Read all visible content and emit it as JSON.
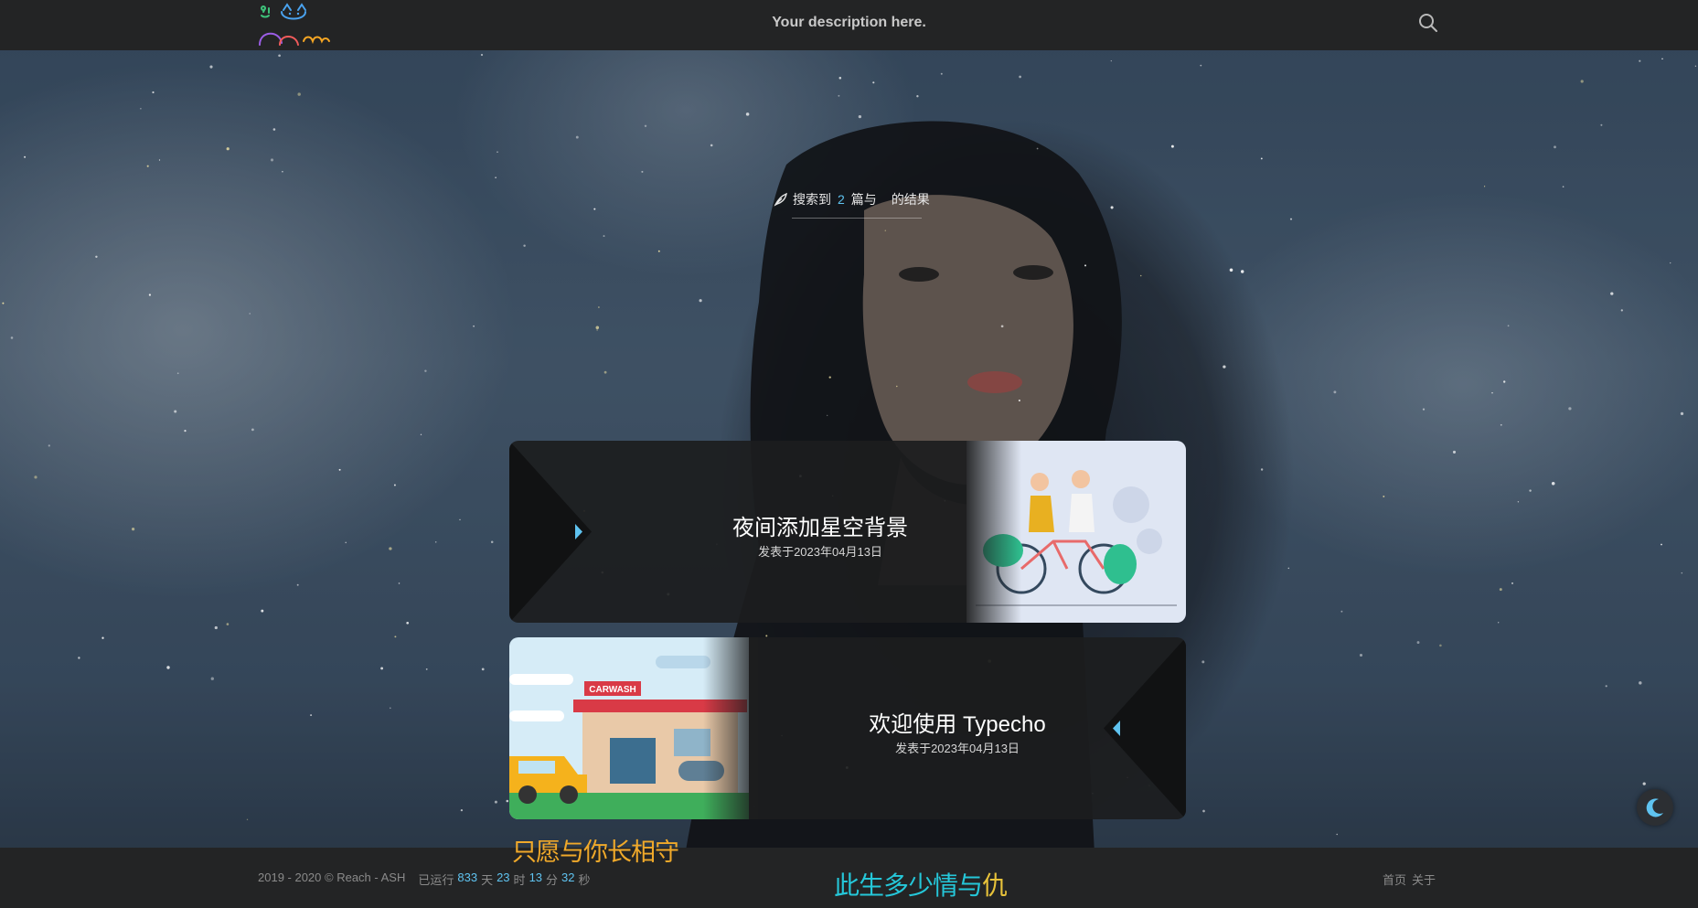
{
  "header": {
    "description": "Your description here.",
    "logo_icon": "cat-doodle-logo",
    "search_icon": "search-icon"
  },
  "search_summary": {
    "prefix": "搜索到",
    "count": "2",
    "middle": "篇与",
    "suffix": "的结果",
    "icon": "feather-icon"
  },
  "posts": [
    {
      "title": "夜间添加星空背景",
      "date": "发表于2023年04月13日",
      "thumb": "tandem-bicycle-illustration"
    },
    {
      "title": "欢迎使用 Typecho",
      "date": "发表于2023年04月13日",
      "thumb": "carwash-illustration",
      "thumb_sign": "CARWASH"
    }
  ],
  "footer": {
    "copyright": "2019 - 2020 © Reach - ASH",
    "runtime_prefix": "已运行",
    "days": "833",
    "days_unit": "天",
    "hours": "23",
    "hours_unit": "时",
    "minutes": "13",
    "minutes_unit": "分",
    "seconds": "32",
    "seconds_unit": "秒",
    "links": [
      "首页",
      "关于"
    ]
  },
  "lyrics": {
    "line1": "只愿与你长相守",
    "line2_a": "此生多少情与",
    "line2_b": "仇"
  },
  "theme_toggle_icon": "moon-icon",
  "colors": {
    "accent": "#5fc3f0",
    "lyric_orange": "#f0a92a",
    "lyric_cyan": "#25c7d9",
    "lyric_yellow": "#e7c23a",
    "bar_bg": "#232425"
  }
}
